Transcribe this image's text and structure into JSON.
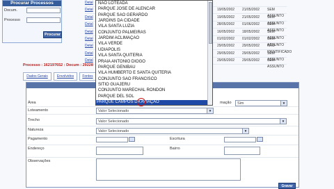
{
  "search": {
    "title": "Procurar Processos",
    "doc_label": "Docum.",
    "proc_label": "Processo",
    "button": "Procurar"
  },
  "results": [
    {
      "detalhes": "Detal",
      "date1": "",
      "date2": "",
      "status": ""
    },
    {
      "detalhes": "Detal",
      "date1": "19/05/2002",
      "date2": "21/05/2002",
      "status": "SEM ASSUNTO"
    },
    {
      "detalhes": "Detal",
      "date1": "19/05/2002",
      "date2": "21/05/2002",
      "status": "SEM ASSUNTO"
    },
    {
      "detalhes": "Detal",
      "date1": "28/05/2002",
      "date2": "01/06/2002",
      "status": "SEM ASSUNTO"
    },
    {
      "detalhes": "Detal",
      "date1": "16/05/2002",
      "date2": "18/05/2002",
      "status": "SEM ASSUNTO"
    },
    {
      "detalhes": "Detal",
      "date1": "01/02/2002",
      "date2": "01/02/2002",
      "status": "SEM ASSUNTO"
    },
    {
      "detalhes": "Detal",
      "date1": "29/05/2002",
      "date2": "29/05/2002",
      "status": "NÃO IDENTIFICADO"
    },
    {
      "detalhes": "Detal",
      "date1": "29/05/2002",
      "date2": "29/05/2002",
      "status": "SEM ASSUNTO"
    },
    {
      "detalhes": "Detal",
      "date1": "29/05/2002",
      "date2": "29/05/2002",
      "status": "SEM ASSUNTO"
    }
  ],
  "process_line": "Processo : 162197652 : Docum : 29228",
  "tabs": [
    "Dados Gerais",
    "Envolvidos",
    "Fontes"
  ],
  "form": {
    "area_label": "Área",
    "area_right_label": "mação",
    "area_right_value": "Sim",
    "loteamento_label": "Loteamento",
    "loteamento_value": "Valor Selecionado",
    "trecho_label": "Trecho",
    "trecho_value": "Valor Selecionado",
    "natureza_label": "Natureza",
    "natureza_value": "Valor Selecionado",
    "pagamento_label": "Pagamento",
    "escritura_label": "Escritura",
    "endereco_label": "Endereço",
    "bairro_label": "Bairro",
    "observacoes_label": "Observações",
    "save_button": "Gravar"
  },
  "dropdown": {
    "items": [
      "NÃO LOTEADA",
      "PARQUE JOSE DE ALENCAR",
      "PARQUE SAO GERARDO",
      "JARDINS DA CIDADE",
      "VILA SANTA LUZIA",
      "CONJUNTO PALMEIRAS",
      "JARDIM ACLIMAÇAO",
      "VILA VERDE",
      "UDIAPOLIS",
      "VILA SANTA QUITERIA",
      "PRAIA ANTONIO DIOGO",
      "PARQUE GENIBAU",
      "VILA HUMBERTO E SANTA QUITERIA",
      "CONJUNTO SAO FRANCISCO",
      "SITIO GUAJERU",
      "CONJUNTO MARECHAL RONDON",
      "PARQUE DEL SOL",
      "PARQUE CAMPOS DA AVIAÇAO"
    ],
    "selected_index": 17
  },
  "colors": {
    "header_blue": "#355c9b",
    "selection_blue": "#1f49a6",
    "process_red": "#c01818",
    "cursor_red": "#cc1212"
  }
}
